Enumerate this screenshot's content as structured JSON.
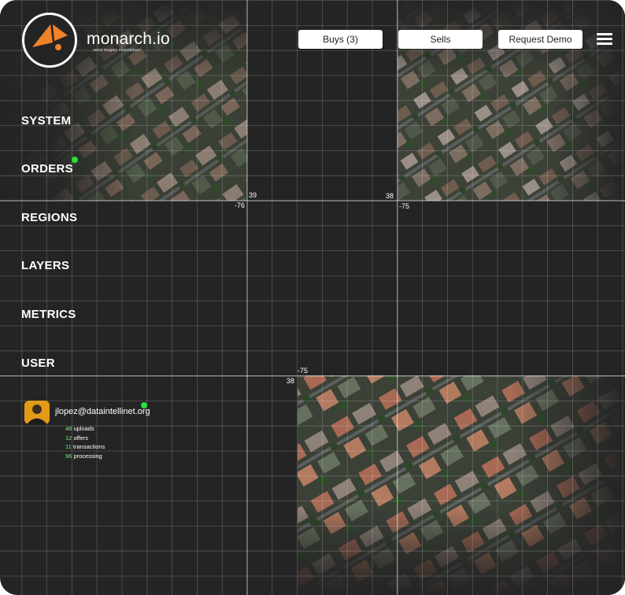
{
  "brand": {
    "name": "monarch.io",
    "tagline": "aerial imagery marketplace"
  },
  "header": {
    "buys_label": "Buys (3)",
    "sells_label": "Sells",
    "demo_label": "Request Demo"
  },
  "nav": {
    "items": [
      {
        "label": "SYSTEM"
      },
      {
        "label": "ORDERS",
        "has_status_dot": true
      },
      {
        "label": "REGIONS"
      },
      {
        "label": "LAYERS"
      },
      {
        "label": "METRICS"
      },
      {
        "label": "USER"
      }
    ]
  },
  "coords": {
    "tile1_lat": "39",
    "tile1_lon": "-76",
    "tile2_lat": "38",
    "tile2_lon": "-75",
    "tile3_lat": "38",
    "tile3_lon": "-75"
  },
  "user": {
    "email": "jlopez@dataintellinet.org",
    "stats": [
      {
        "value": "48",
        "label": "uploads"
      },
      {
        "value": "12",
        "label": "offers"
      },
      {
        "value": "11",
        "label": "transactions"
      },
      {
        "value": "96",
        "label": "processing"
      }
    ]
  },
  "colors": {
    "background": "#242424",
    "status_dot": "#22e33a",
    "logo_accent": "#f0822a",
    "stat_number": "#6ef07a"
  }
}
